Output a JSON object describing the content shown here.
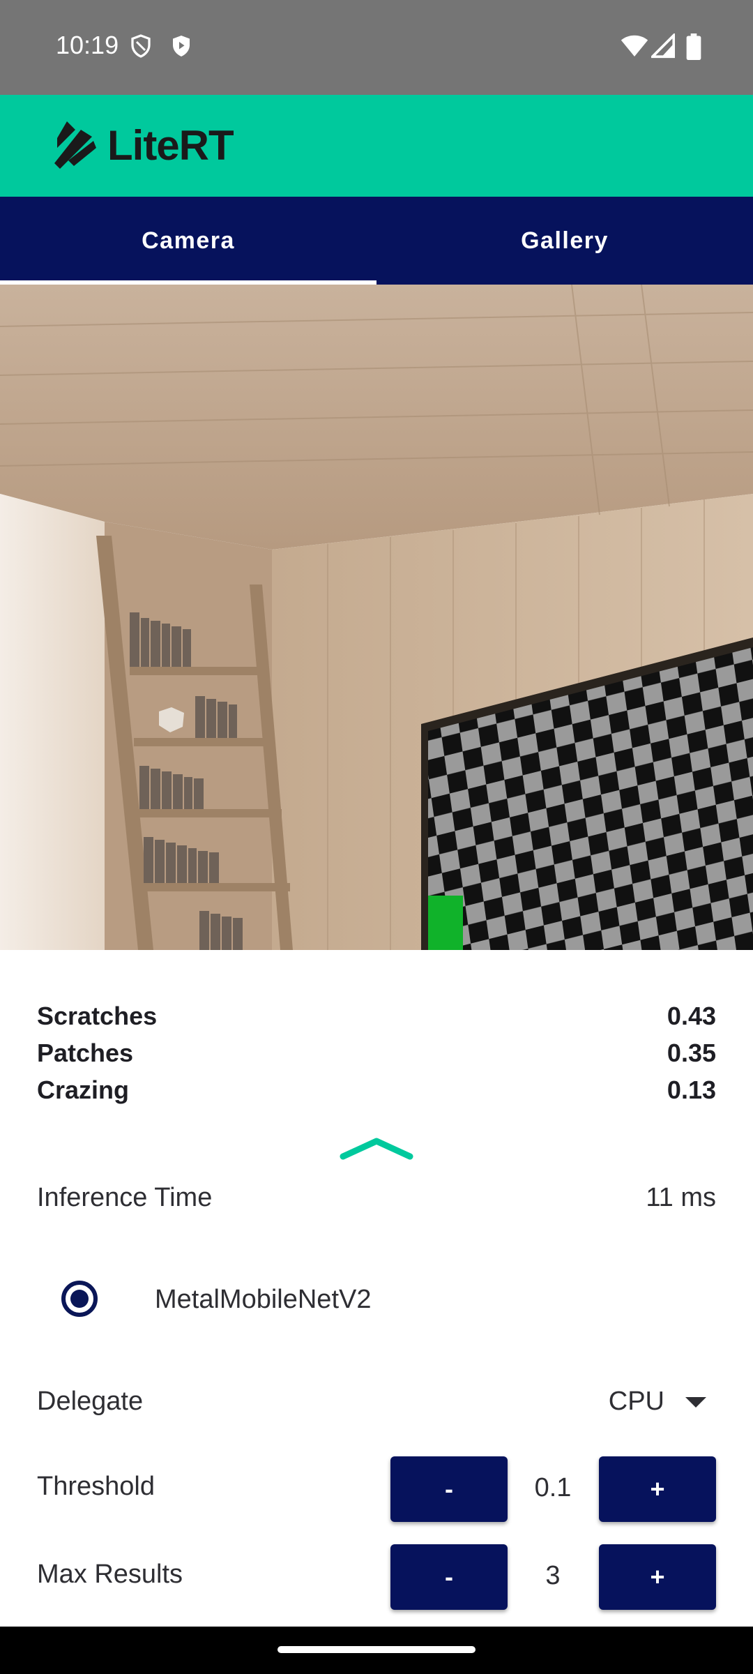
{
  "status_bar": {
    "time": "10:19",
    "left_icons": [
      "shield-outline-icon",
      "shield-play-icon"
    ],
    "right_icons": [
      "wifi-icon",
      "cell-signal-icon",
      "battery-icon"
    ]
  },
  "app_bar": {
    "logo_text": "LiteRT",
    "accent": "#00c99d"
  },
  "tabs": [
    {
      "label": "Camera",
      "active": true
    },
    {
      "label": "Gallery",
      "active": false
    }
  ],
  "colors": {
    "primary": "#06125c",
    "accent": "#00c99d",
    "indicator": "#00c99d"
  },
  "results": [
    {
      "label": "Scratches",
      "score": "0.43"
    },
    {
      "label": "Patches",
      "score": "0.35"
    },
    {
      "label": "Crazing",
      "score": "0.13"
    }
  ],
  "settings": {
    "inference_label": "Inference Time",
    "inference_value": "11 ms",
    "model_option": "MetalMobileNetV2",
    "delegate_label": "Delegate",
    "delegate_value": "CPU",
    "threshold_label": "Threshold",
    "threshold_value": "0.1",
    "max_results_label": "Max Results",
    "max_results_value": "3",
    "minus_label": "-",
    "plus_label": "+"
  }
}
